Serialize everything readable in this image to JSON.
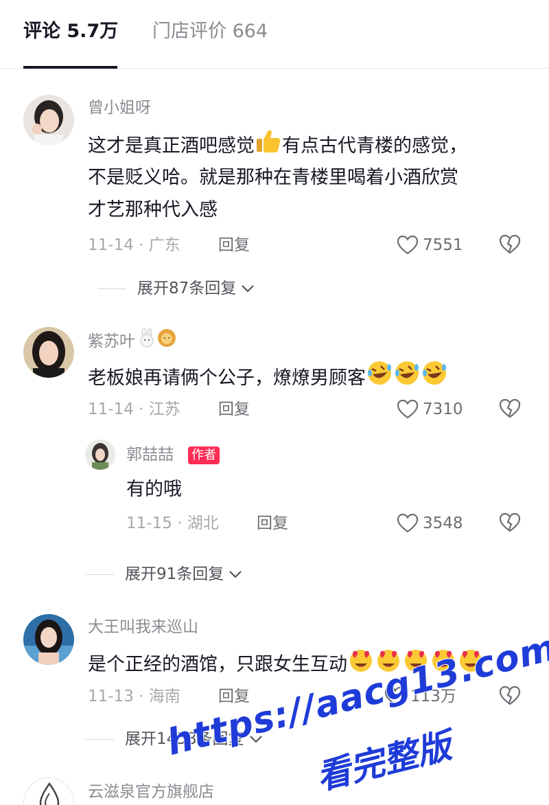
{
  "tabs": {
    "comments_label": "评论 5.7万",
    "reviews_label": "门店评价 664"
  },
  "comments": [
    {
      "username": "曾小姐呀",
      "text_line1_a": "这才是真正酒吧感觉",
      "text_line1_b": "有点古代青楼的感觉，",
      "text_line2": "不是贬义哈。就是那种在青楼里喝着小酒欣赏",
      "text_line3": "才艺那种代入感",
      "date": "11-14",
      "location": "广东",
      "reply_label": "回复",
      "likes": "7551",
      "expand_label": "展开87条回复"
    },
    {
      "username": "紫苏叶",
      "text": "老板娘再请俩个公子，燎燎男顾客",
      "date": "11-14",
      "location": "江苏",
      "reply_label": "回复",
      "likes": "7310",
      "reply": {
        "username": "郭喆喆",
        "badge": "作者",
        "text": "有的哦",
        "date": "11-15",
        "location": "湖北",
        "reply_label": "回复",
        "likes": "3548"
      },
      "expand_label": "展开91条回复"
    },
    {
      "username": "大王叫我来巡山",
      "text": "是个正经的酒馆，只跟女生互动",
      "date": "11-13",
      "location": "海南",
      "reply_label": "回复",
      "likes": "113万",
      "expand_label": "展开1458条回复"
    },
    {
      "username": "云滋泉官方旗舰店"
    }
  ],
  "watermark": {
    "url": "https://aacg13.com",
    "text": "看完整版"
  },
  "colors": {
    "primary_text": "#161823",
    "secondary_text": "#8a8b91",
    "author_badge": "#fe2c55",
    "watermark": "#1f3cd8"
  },
  "icons": [
    "heart-icon",
    "broken-heart-icon",
    "chevron-down-icon",
    "thumbs-up-emoji",
    "rofl-emoji",
    "heart-eyes-emoji",
    "rabbit-emoji",
    "lion-emoji",
    "water-drop-logo"
  ]
}
